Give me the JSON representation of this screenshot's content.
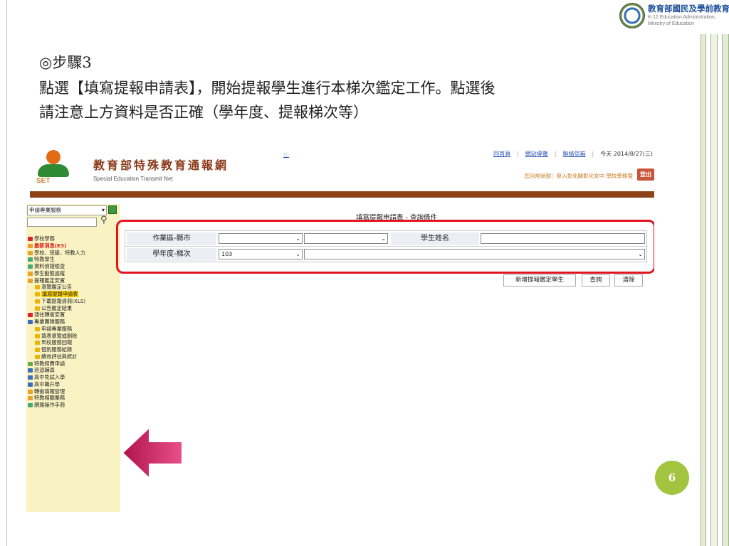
{
  "logo": {
    "title": "教育部國民及學前教育署",
    "en_line1": "K-12 Education Administration,",
    "en_line2": "Ministry of Education"
  },
  "slide": {
    "step_title": "◎步驟3",
    "line1": "點選【填寫提報申請表】，開始提報學生進行本梯次鑑定工作。點選後",
    "line2": "請注意上方資料是否正確（學年度、提報梯次等）",
    "page_number": "6"
  },
  "site": {
    "name_cn": "教育部特殊教育通報網",
    "name_en": "Special Education Transmit Net",
    "logo_text": "SET",
    "dots_link": ":::",
    "nav_home": "回首頁",
    "nav_sitemap": "網站導覽",
    "nav_contact": "聯絡信箱",
    "nav_date": "今天 2014/8/27(三)",
    "status": "您目前狀態：登入彰化縣彰化女中 學校學務暨",
    "logout": "登出"
  },
  "sidebar": {
    "select_value": "申請專業服務",
    "items": [
      {
        "label": "學校學務",
        "color": "#d23",
        "style": ""
      },
      {
        "label": "最新消息(E3)",
        "color": "#e8a12a",
        "style": "red"
      },
      {
        "label": "學校、班級、特教人力",
        "color": "#e8a12a",
        "style": ""
      },
      {
        "label": "特教學生",
        "color": "#4a7",
        "style": ""
      },
      {
        "label": "資料偵錯檢查",
        "color": "#4a7",
        "style": ""
      },
      {
        "label": "學生動態追蹤",
        "color": "#e8a12a",
        "style": ""
      },
      {
        "label": "提報鑑定安置",
        "color": "#e8a12a",
        "style": ""
      },
      {
        "label": "瀏覽鑑定公告",
        "color": "#f0b400",
        "style": ""
      },
      {
        "label": "填寫提報申請表",
        "color": "#f0b400",
        "style": "hl"
      },
      {
        "label": "下載提報清冊(XLS)",
        "color": "#f0b400",
        "style": ""
      },
      {
        "label": "公告鑑定結果",
        "color": "#f0b400",
        "style": ""
      },
      {
        "label": "通往轉銜安置",
        "color": "#d23",
        "style": ""
      },
      {
        "label": "專業團隊服務",
        "color": "#3a6fc0",
        "style": ""
      },
      {
        "label": "申請專業服務",
        "color": "#f0b400",
        "style": ""
      },
      {
        "label": "填表瀏覽或刪除",
        "color": "#f0b400",
        "style": ""
      },
      {
        "label": "到校服務回報",
        "color": "#f0b400",
        "style": ""
      },
      {
        "label": "個別服務紀錄",
        "color": "#f0b400",
        "style": ""
      },
      {
        "label": "績效評估與統計",
        "color": "#f0b400",
        "style": ""
      },
      {
        "label": "特教經費申請",
        "color": "#6a4",
        "style": ""
      },
      {
        "label": "巡迴輔導",
        "color": "#3a6fc0",
        "style": ""
      },
      {
        "label": "高中免試入學",
        "color": "#3a6fc0",
        "style": ""
      },
      {
        "label": "高中職升學",
        "color": "#3a6fc0",
        "style": ""
      },
      {
        "label": "轉銜填報管理",
        "color": "#e8a12a",
        "style": ""
      },
      {
        "label": "特教相關業務",
        "color": "#e8a12a",
        "style": ""
      },
      {
        "label": "網路操作手冊",
        "color": "#4a7",
        "style": ""
      }
    ]
  },
  "query": {
    "title": "填寫提報申請表 - 查詢條件",
    "label_area": "作業區-縣市",
    "label_student": "學生姓名",
    "label_year": "學年度-梯次",
    "year_value": "103",
    "btn_add": "新增提報鑑定學生",
    "btn_search": "查詢",
    "btn_clear": "清除"
  },
  "colors": {
    "accent_red": "#e2141f",
    "arrow_pink": "#d6205f",
    "page_green": "#a2c43f",
    "band_brown": "#8d4318"
  }
}
